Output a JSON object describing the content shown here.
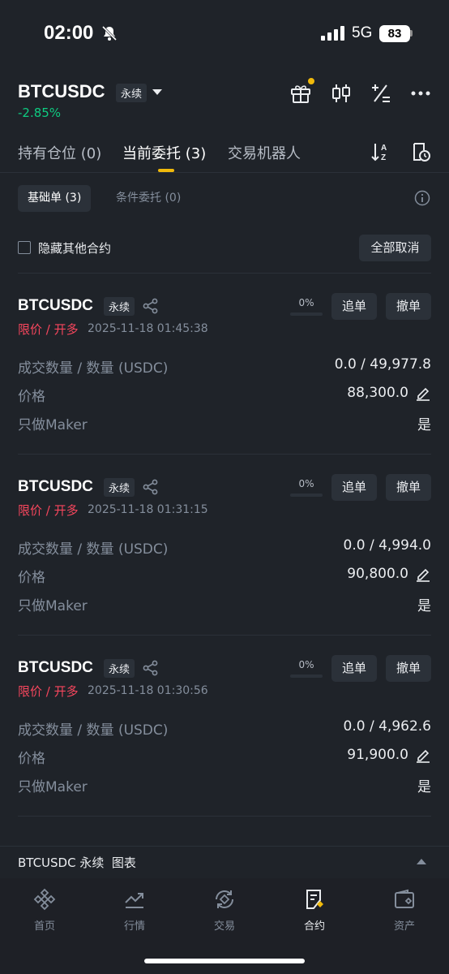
{
  "status_bar": {
    "time": "02:00",
    "network": "5G",
    "battery": "83"
  },
  "header": {
    "symbol": "BTCUSDC",
    "perp_badge": "永续",
    "change": "-2.85%",
    "change_color": "#0ecb81",
    "icons": [
      "gift-icon",
      "candlestick-icon",
      "calculator-icon",
      "more-icon"
    ]
  },
  "tabs": [
    {
      "label": "持有仓位 (0)"
    },
    {
      "label": "当前委托 (3)",
      "active": true
    },
    {
      "label": "交易机器人"
    }
  ],
  "subtabs": [
    {
      "label": "基础单 (3)",
      "active": true
    },
    {
      "label": "条件委托 (0)"
    }
  ],
  "filter": {
    "hide_label": "隐藏其他合约",
    "cancel_all": "全部取消"
  },
  "orders": [
    {
      "symbol": "BTCUSDC",
      "badge": "永续",
      "progress": "0%",
      "chase": "追单",
      "cancel": "撤单",
      "type": "限价 / 开多",
      "time": "2025-11-18 01:45:38",
      "qty_label": "成交数量 / 数量 (USDC)",
      "qty": "0.0 / 49,977.8",
      "price_label": "价格",
      "price": "88,300.0",
      "maker_label": "只做Maker",
      "maker": "是"
    },
    {
      "symbol": "BTCUSDC",
      "badge": "永续",
      "progress": "0%",
      "chase": "追单",
      "cancel": "撤单",
      "type": "限价 / 开多",
      "time": "2025-11-18 01:31:15",
      "qty_label": "成交数量 / 数量 (USDC)",
      "qty": "0.0 / 4,994.0",
      "price_label": "价格",
      "price": "90,800.0",
      "maker_label": "只做Maker",
      "maker": "是"
    },
    {
      "symbol": "BTCUSDC",
      "badge": "永续",
      "progress": "0%",
      "chase": "追单",
      "cancel": "撤单",
      "type": "限价 / 开多",
      "time": "2025-11-18 01:30:56",
      "qty_label": "成交数量 / 数量 (USDC)",
      "qty": "0.0 / 4,962.6",
      "price_label": "价格",
      "price": "91,900.0",
      "maker_label": "只做Maker",
      "maker": "是"
    }
  ],
  "chart_bar": {
    "label": "BTCUSDC 永续  图表"
  },
  "nav": [
    {
      "label": "首页",
      "icon": "home-icon"
    },
    {
      "label": "行情",
      "icon": "markets-icon"
    },
    {
      "label": "交易",
      "icon": "trade-icon"
    },
    {
      "label": "合约",
      "icon": "futures-icon",
      "active": true
    },
    {
      "label": "资产",
      "icon": "wallet-icon"
    }
  ],
  "colors": {
    "accent": "#f0b90b",
    "sell": "#f6465d",
    "buy": "#0ecb81",
    "bg": "#1f2329"
  }
}
